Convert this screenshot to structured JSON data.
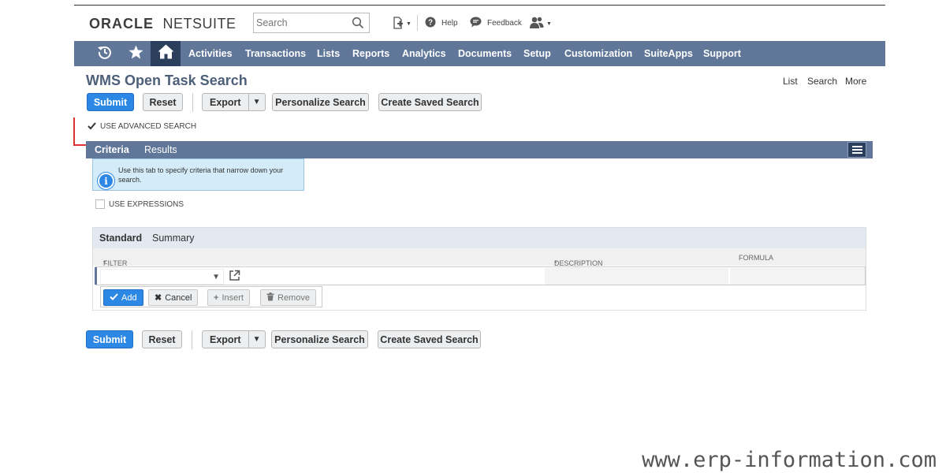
{
  "header": {
    "logo": {
      "bold": "ORACLE",
      "thin": "NETSUITE"
    },
    "search_placeholder": "Search",
    "help_label": "Help",
    "feedback_label": "Feedback"
  },
  "nav": {
    "items": [
      "Activities",
      "Transactions",
      "Lists",
      "Reports",
      "Analytics",
      "Documents",
      "Setup",
      "Customization",
      "SuiteApps",
      "Support"
    ]
  },
  "page": {
    "title": "WMS Open Task Search",
    "top_links": [
      "List",
      "Search",
      "More"
    ]
  },
  "toolbar": {
    "submit": "Submit",
    "reset": "Reset",
    "export": "Export",
    "personalize": "Personalize Search",
    "create_saved": "Create Saved Search"
  },
  "options": {
    "use_advanced_search": "USE ADVANCED SEARCH",
    "use_advanced_search_checked": true,
    "use_expressions": "USE EXPRESSIONS",
    "use_expressions_checked": false
  },
  "tabs": {
    "criteria": "Criteria",
    "results": "Results"
  },
  "info": {
    "text": "Use this tab to specify criteria that narrow down your search."
  },
  "subtabs": {
    "standard": "Standard",
    "summary": "Summary"
  },
  "columns": {
    "filter": "FILTER",
    "description": "DESCRIPTION",
    "formula": "FORMULA"
  },
  "row_actions": {
    "add": "Add",
    "cancel": "Cancel",
    "insert": "Insert",
    "remove": "Remove"
  },
  "watermark": "www.erp-information.com",
  "colors": {
    "nav_bg": "#607799",
    "nav_active": "#2b3e5c",
    "primary_button": "#2d88e5",
    "title": "#4d5f79",
    "info_bg": "#d4ecfa",
    "annotation_red": "#e03030"
  }
}
